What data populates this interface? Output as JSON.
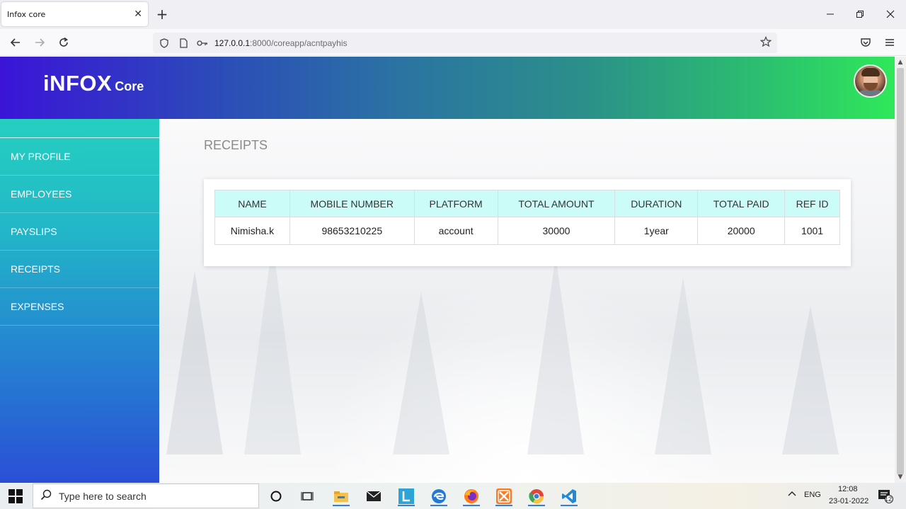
{
  "browser": {
    "tab_title": "Infox core",
    "tab_close": "✕",
    "new_tab": "+",
    "url_host": "127.0.0.1",
    "url_rest": ":8000/coreapp/acntpayhis"
  },
  "app": {
    "logo_main": "iNFOX",
    "logo_sub": "Core"
  },
  "sidebar": {
    "items": [
      {
        "label": "MY PROFILE"
      },
      {
        "label": "EMPLOYEES"
      },
      {
        "label": "PAYSLIPS"
      },
      {
        "label": "RECEIPTS"
      },
      {
        "label": "EXPENSES"
      }
    ]
  },
  "main": {
    "title": "RECEIPTS",
    "table": {
      "headers": [
        "NAME",
        "MOBILE NUMBER",
        "PLATFORM",
        "TOTAL AMOUNT",
        "DURATION",
        "TOTAL PAID",
        "REF ID"
      ],
      "rows": [
        [
          "Nimisha.k",
          "98653210225",
          "account",
          "30000",
          "1year",
          "20000",
          "1001"
        ]
      ]
    }
  },
  "taskbar": {
    "search_placeholder": "Type here to search",
    "language": "ENG",
    "time": "12:08",
    "date": "23-01-2022",
    "notification_count": "12"
  },
  "colors": {
    "header_gradient_start": "#3b14d8",
    "header_gradient_end": "#2fe85a",
    "sidebar_top": "#25d0bf",
    "sidebar_bottom": "#2a4fd6",
    "table_header_bg": "#ccfcf8"
  }
}
